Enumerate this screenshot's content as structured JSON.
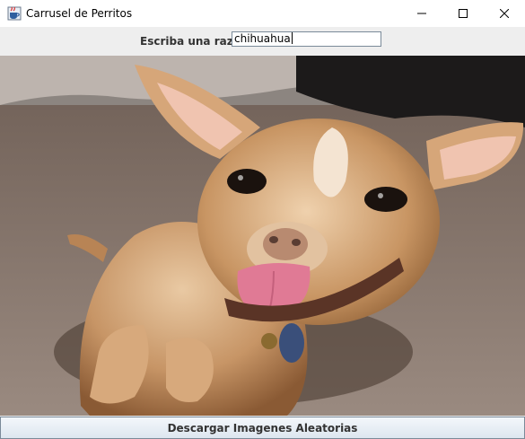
{
  "window": {
    "title": "Carrusel de Perritos",
    "app_icon": "java-cup-icon",
    "controls": [
      "minimize-icon",
      "maximize-icon",
      "close-icon"
    ]
  },
  "search": {
    "label": "Escriba una raza:",
    "value": "chihuahua"
  },
  "image": {
    "subject": "chihuahua dog photo"
  },
  "actions": {
    "download_label": "Descargar Imagenes Aleatorias"
  },
  "colors": {
    "titlebar": "#ffffff",
    "panel": "#eeeeee",
    "button_border": "#7a8a99"
  }
}
